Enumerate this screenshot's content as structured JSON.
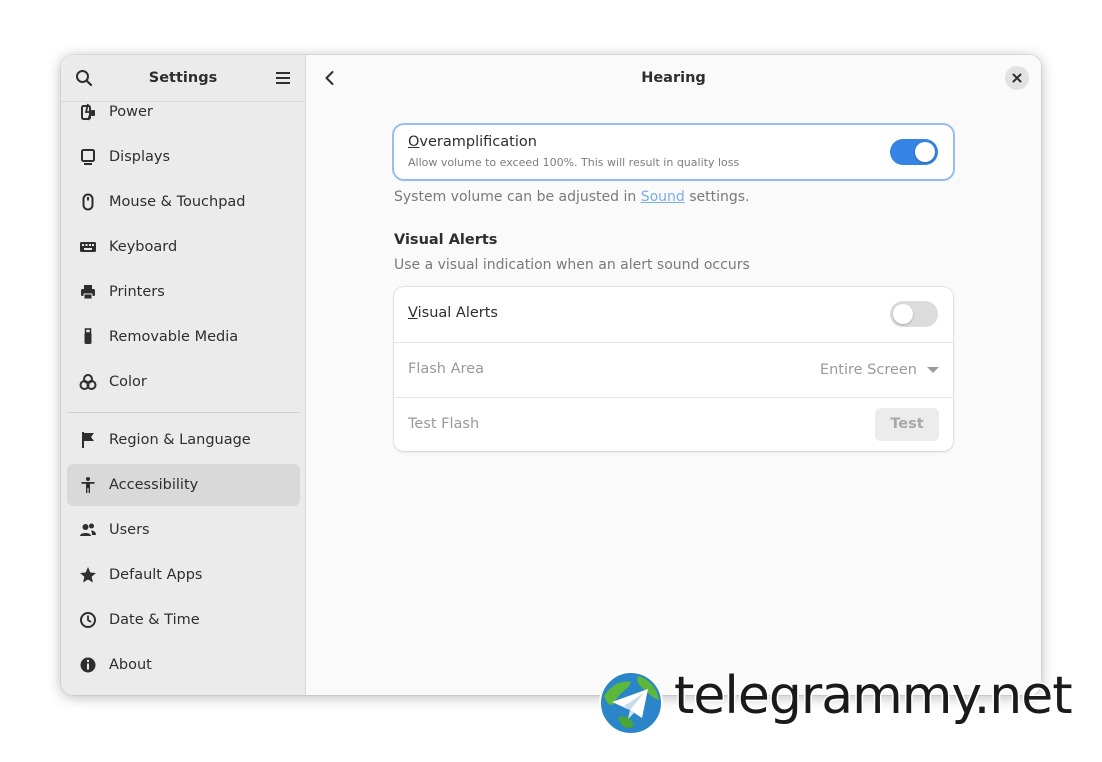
{
  "sidebar": {
    "title": "Settings",
    "items": [
      {
        "label": "Power",
        "icon": "power-icon"
      },
      {
        "label": "Displays",
        "icon": "display-icon"
      },
      {
        "label": "Mouse & Touchpad",
        "icon": "mouse-icon"
      },
      {
        "label": "Keyboard",
        "icon": "keyboard-icon"
      },
      {
        "label": "Printers",
        "icon": "printer-icon"
      },
      {
        "label": "Removable Media",
        "icon": "usb-icon"
      },
      {
        "label": "Color",
        "icon": "color-icon"
      },
      {
        "label": "Region & Language",
        "icon": "flag-icon"
      },
      {
        "label": "Accessibility",
        "icon": "accessibility-icon",
        "active": true
      },
      {
        "label": "Users",
        "icon": "users-icon"
      },
      {
        "label": "Default Apps",
        "icon": "star-icon"
      },
      {
        "label": "Date & Time",
        "icon": "clock-icon"
      },
      {
        "label": "About",
        "icon": "info-icon"
      }
    ]
  },
  "header": {
    "title": "Hearing"
  },
  "overamplification": {
    "title_first": "O",
    "title_rest": "veramplification",
    "subtitle": "Allow volume to exceed 100%. This will result in quality loss",
    "enabled": true
  },
  "volume_note": {
    "before": "System volume can be adjusted in ",
    "link": "Sound",
    "after": " settings."
  },
  "visual_alerts": {
    "section_title": "Visual Alerts",
    "section_description": "Use a visual indication when an alert sound occurs",
    "toggle_first": "V",
    "toggle_rest": "isual Alerts",
    "enabled": false,
    "flash_area_label": "Flash Area",
    "flash_area_value": "Entire Screen",
    "test_flash_label": "Test Flash",
    "test_button": "Test"
  },
  "watermark": {
    "text": "telegrammy.net"
  },
  "colors": {
    "accent": "#3584e4",
    "sidebar_bg": "#ebebeb",
    "content_bg": "#fafafa"
  }
}
